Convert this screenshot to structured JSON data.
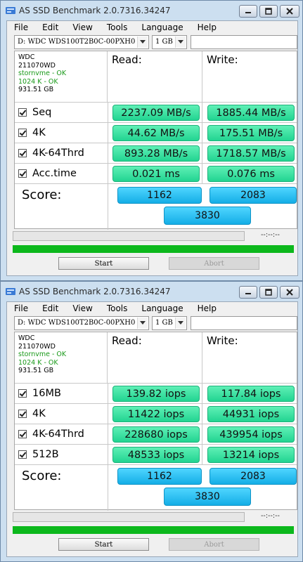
{
  "windows": [
    {
      "title": "AS SSD Benchmark 2.0.7316.34247",
      "menu": [
        "File",
        "Edit",
        "View",
        "Tools",
        "Language",
        "Help"
      ],
      "drive_select": "D: WDC WDS100T2B0C-00PXH0",
      "size_select": "1 GB",
      "info": {
        "model": "WDC",
        "firmware": "211070WD",
        "driver_status": "stornvme - OK",
        "align_status": "1024 K - OK",
        "capacity": "931.51 GB"
      },
      "read_header": "Read:",
      "write_header": "Write:",
      "rows": [
        {
          "label": "Seq",
          "read": "2237.09 MB/s",
          "write": "1885.44 MB/s"
        },
        {
          "label": "4K",
          "read": "44.62 MB/s",
          "write": "175.51 MB/s"
        },
        {
          "label": "4K-64Thrd",
          "read": "893.28 MB/s",
          "write": "1718.57 MB/s"
        },
        {
          "label": "Acc.time",
          "read": "0.021 ms",
          "write": "0.076 ms"
        }
      ],
      "score_label": "Score:",
      "score_read": "1162",
      "score_write": "2083",
      "score_total": "3830",
      "time_text": "--:--:--",
      "progress_percent": 0,
      "start_label": "Start",
      "abort_label": "Abort"
    },
    {
      "title": "AS SSD Benchmark 2.0.7316.34247",
      "menu": [
        "File",
        "Edit",
        "View",
        "Tools",
        "Language",
        "Help"
      ],
      "drive_select": "D: WDC WDS100T2B0C-00PXH0",
      "size_select": "1 GB",
      "info": {
        "model": "WDC",
        "firmware": "211070WD",
        "driver_status": "stornvme - OK",
        "align_status": "1024 K - OK",
        "capacity": "931.51 GB"
      },
      "read_header": "Read:",
      "write_header": "Write:",
      "rows": [
        {
          "label": "16MB",
          "read": "139.82 iops",
          "write": "117.84 iops"
        },
        {
          "label": "4K",
          "read": "11422 iops",
          "write": "44931 iops"
        },
        {
          "label": "4K-64Thrd",
          "read": "228680 iops",
          "write": "439954 iops"
        },
        {
          "label": "512B",
          "read": "48533 iops",
          "write": "13214 iops"
        }
      ],
      "score_label": "Score:",
      "score_read": "1162",
      "score_write": "2083",
      "score_total": "3830",
      "time_text": "--:--:--",
      "progress_percent": 0,
      "start_label": "Start",
      "abort_label": "Abort"
    }
  ],
  "colors": {
    "result_green": "#33dd9c",
    "score_blue": "#25bdf0",
    "progress_green": "#0cb81c",
    "frame": "#ccdff0"
  },
  "icons": [
    "app-icon",
    "minimize-icon",
    "maximize-icon",
    "close-icon",
    "chevron-down-icon",
    "checkbox-checked-icon"
  ]
}
